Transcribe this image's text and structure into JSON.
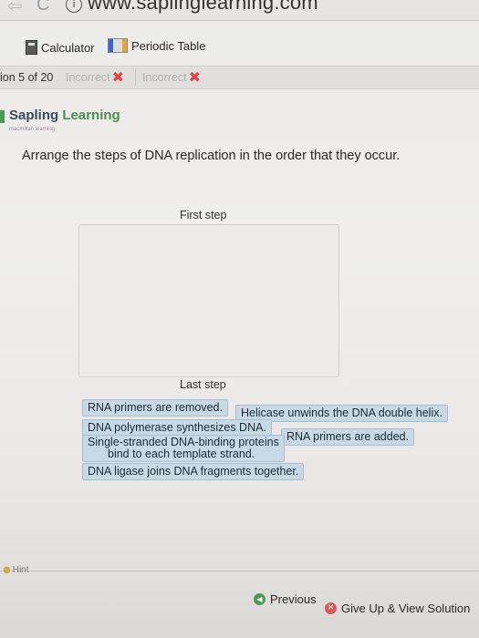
{
  "browser": {
    "url": "www.saplinglearning.com",
    "back_glyph": "⇦",
    "reload_glyph": "C",
    "info_glyph": "i"
  },
  "toolbar": {
    "calculator_label": "Calculator",
    "periodic_table_label": "Periodic Table",
    "calculator_icon": "calculator-icon",
    "periodic_table_icon": "periodic-table-icon"
  },
  "status": {
    "question_number": "ion 5 of 20",
    "attempts": [
      {
        "label": "Incorrect",
        "mark": "✖"
      },
      {
        "label": "Incorrect",
        "mark": "✖"
      }
    ],
    "incorrect_color": "#e04848"
  },
  "brand": {
    "word1": "Sapling",
    "word2": "Learning",
    "tagline": "macmillan learning",
    "accent": "#4a8f4f"
  },
  "question": {
    "prompt": "Arrange the steps of DNA replication in the order that they occur.",
    "first_label": "First step",
    "last_label": "Last step"
  },
  "options": [
    {
      "line1": "RNA primers are removed.",
      "line2": ""
    },
    {
      "line1": "Helicase unwinds the DNA double helix.",
      "line2": ""
    },
    {
      "line1": "DNA polymerase synthesizes DNA.",
      "line2": ""
    },
    {
      "line1": "RNA primers are added.",
      "line2": ""
    },
    {
      "line1": "Single-stranded DNA-binding proteins",
      "line2": "bind to each template strand."
    },
    {
      "line1": "DNA ligase joins DNA fragments together.",
      "line2": ""
    }
  ],
  "option_color": "#c8d9e6",
  "footer": {
    "hint_label": "Hint",
    "hint_icon": "lightbulb-icon",
    "previous_label": "Previous",
    "previous_icon": "arrow-left-circle-icon",
    "previous_glyph": "◀",
    "giveup_label": "Give Up & View Solution",
    "giveup_icon": "give-up-icon",
    "giveup_glyph": "✕"
  }
}
